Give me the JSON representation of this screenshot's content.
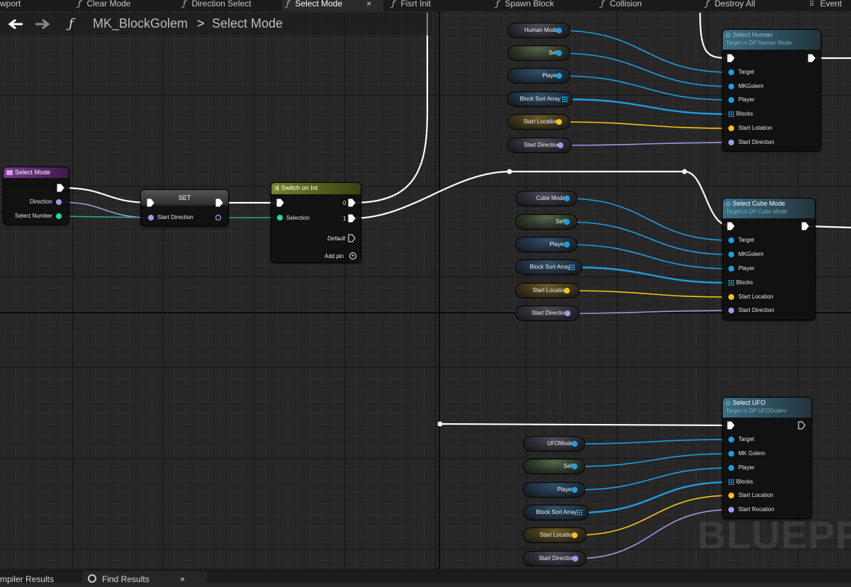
{
  "tabs": [
    "wport",
    "Clear Mode",
    "Direction Select",
    "Select Mode",
    "Fisrt Init",
    "Spawn Block",
    "Collision",
    "Destroy All",
    "Event"
  ],
  "active_tab_close": "×",
  "breadcrumb": {
    "back": "🡐",
    "forward": "🡒",
    "root": "MK_BlockGolem",
    "separator": ">",
    "current": "Select Mode"
  },
  "nodes": {
    "select_mode": {
      "title": "Select Mode",
      "pins": [
        "Direction",
        "Select Number"
      ]
    },
    "set": {
      "title": "SET",
      "pin": "Start Direction"
    },
    "switch": {
      "title": "Switch on Int",
      "selection": "Selection",
      "out0": "0",
      "out1": "1",
      "default": "Default",
      "add_pin": "Add pin"
    },
    "select_human": {
      "title": "Select Human",
      "subtitle": "Target is DP Human Mode",
      "pins": [
        "Target",
        "MKGolem",
        "Player",
        "Blocks",
        "Start Lotation",
        "Start Direction"
      ]
    },
    "select_cube": {
      "title": "Select Cube Mode",
      "subtitle": "Target is DP Cube Mode",
      "pins": [
        "Target",
        "MKGolem",
        "Player",
        "Blocks",
        "Start Location",
        "Start Direction"
      ]
    },
    "select_ufo": {
      "title": "Select UFO",
      "subtitle": "Target is DP UFOGolem",
      "pins": [
        "Target",
        "MK Golem",
        "Player",
        "Blocks",
        "Start Location",
        "Start Rocation"
      ]
    }
  },
  "variables": {
    "human": [
      "Human Mode",
      "Self",
      "Player",
      "Block Sort Array",
      "Start Location",
      "Start Direction"
    ],
    "cube": [
      "Cube Mode",
      "Self",
      "Player",
      "Block Sort Array",
      "Start Location",
      "Start Direction"
    ],
    "ufo": [
      "UFOMode",
      "Self",
      "Player",
      "Block Sort Array",
      "Start Location",
      "Start Direction"
    ]
  },
  "watermark": "BLUEPRI",
  "bottom_tabs": {
    "compiler": "mpiler Results",
    "find": "Find Results",
    "find_close": "×"
  },
  "colors": {
    "exec": "#ffffff",
    "object": "#1e9ee0",
    "vector": "#f6c319",
    "rotator": "#9b9ce8",
    "int": "#21d9a5",
    "function_header": "#5a2a6a",
    "switch_header": "#5e6a1a",
    "call_header": "#3b6e83"
  }
}
